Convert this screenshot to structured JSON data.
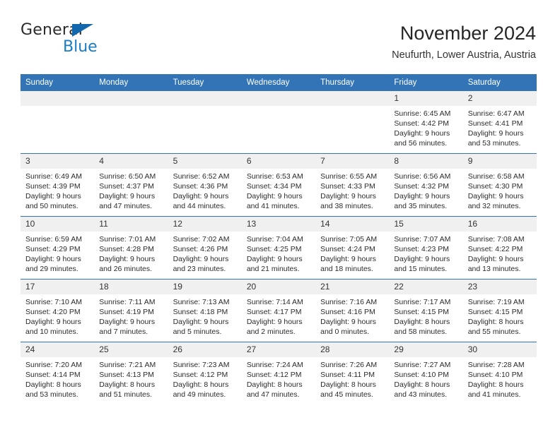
{
  "brand": {
    "name_top": "General",
    "name_bottom": "Blue",
    "triangle_color": "#1368ad",
    "blue_color": "#1b7cc4"
  },
  "header": {
    "title": "November 2024",
    "location": "Neufurth, Lower Austria, Austria"
  },
  "theme": {
    "header_blue": "#3274b5",
    "daynum_band": "#f0f0f0",
    "text": "#2b2b2b"
  },
  "calendar": {
    "weekday_headers": [
      "Sunday",
      "Monday",
      "Tuesday",
      "Wednesday",
      "Thursday",
      "Friday",
      "Saturday"
    ],
    "weeks": [
      [
        {
          "day": "",
          "empty": true
        },
        {
          "day": "",
          "empty": true
        },
        {
          "day": "",
          "empty": true
        },
        {
          "day": "",
          "empty": true
        },
        {
          "day": "",
          "empty": true
        },
        {
          "day": "1",
          "sunrise": "Sunrise: 6:45 AM",
          "sunset": "Sunset: 4:42 PM",
          "daylight1": "Daylight: 9 hours",
          "daylight2": "and 56 minutes."
        },
        {
          "day": "2",
          "sunrise": "Sunrise: 6:47 AM",
          "sunset": "Sunset: 4:41 PM",
          "daylight1": "Daylight: 9 hours",
          "daylight2": "and 53 minutes."
        }
      ],
      [
        {
          "day": "3",
          "sunrise": "Sunrise: 6:49 AM",
          "sunset": "Sunset: 4:39 PM",
          "daylight1": "Daylight: 9 hours",
          "daylight2": "and 50 minutes."
        },
        {
          "day": "4",
          "sunrise": "Sunrise: 6:50 AM",
          "sunset": "Sunset: 4:37 PM",
          "daylight1": "Daylight: 9 hours",
          "daylight2": "and 47 minutes."
        },
        {
          "day": "5",
          "sunrise": "Sunrise: 6:52 AM",
          "sunset": "Sunset: 4:36 PM",
          "daylight1": "Daylight: 9 hours",
          "daylight2": "and 44 minutes."
        },
        {
          "day": "6",
          "sunrise": "Sunrise: 6:53 AM",
          "sunset": "Sunset: 4:34 PM",
          "daylight1": "Daylight: 9 hours",
          "daylight2": "and 41 minutes."
        },
        {
          "day": "7",
          "sunrise": "Sunrise: 6:55 AM",
          "sunset": "Sunset: 4:33 PM",
          "daylight1": "Daylight: 9 hours",
          "daylight2": "and 38 minutes."
        },
        {
          "day": "8",
          "sunrise": "Sunrise: 6:56 AM",
          "sunset": "Sunset: 4:32 PM",
          "daylight1": "Daylight: 9 hours",
          "daylight2": "and 35 minutes."
        },
        {
          "day": "9",
          "sunrise": "Sunrise: 6:58 AM",
          "sunset": "Sunset: 4:30 PM",
          "daylight1": "Daylight: 9 hours",
          "daylight2": "and 32 minutes."
        }
      ],
      [
        {
          "day": "10",
          "sunrise": "Sunrise: 6:59 AM",
          "sunset": "Sunset: 4:29 PM",
          "daylight1": "Daylight: 9 hours",
          "daylight2": "and 29 minutes."
        },
        {
          "day": "11",
          "sunrise": "Sunrise: 7:01 AM",
          "sunset": "Sunset: 4:28 PM",
          "daylight1": "Daylight: 9 hours",
          "daylight2": "and 26 minutes."
        },
        {
          "day": "12",
          "sunrise": "Sunrise: 7:02 AM",
          "sunset": "Sunset: 4:26 PM",
          "daylight1": "Daylight: 9 hours",
          "daylight2": "and 23 minutes."
        },
        {
          "day": "13",
          "sunrise": "Sunrise: 7:04 AM",
          "sunset": "Sunset: 4:25 PM",
          "daylight1": "Daylight: 9 hours",
          "daylight2": "and 21 minutes."
        },
        {
          "day": "14",
          "sunrise": "Sunrise: 7:05 AM",
          "sunset": "Sunset: 4:24 PM",
          "daylight1": "Daylight: 9 hours",
          "daylight2": "and 18 minutes."
        },
        {
          "day": "15",
          "sunrise": "Sunrise: 7:07 AM",
          "sunset": "Sunset: 4:23 PM",
          "daylight1": "Daylight: 9 hours",
          "daylight2": "and 15 minutes."
        },
        {
          "day": "16",
          "sunrise": "Sunrise: 7:08 AM",
          "sunset": "Sunset: 4:22 PM",
          "daylight1": "Daylight: 9 hours",
          "daylight2": "and 13 minutes."
        }
      ],
      [
        {
          "day": "17",
          "sunrise": "Sunrise: 7:10 AM",
          "sunset": "Sunset: 4:20 PM",
          "daylight1": "Daylight: 9 hours",
          "daylight2": "and 10 minutes."
        },
        {
          "day": "18",
          "sunrise": "Sunrise: 7:11 AM",
          "sunset": "Sunset: 4:19 PM",
          "daylight1": "Daylight: 9 hours",
          "daylight2": "and 7 minutes."
        },
        {
          "day": "19",
          "sunrise": "Sunrise: 7:13 AM",
          "sunset": "Sunset: 4:18 PM",
          "daylight1": "Daylight: 9 hours",
          "daylight2": "and 5 minutes."
        },
        {
          "day": "20",
          "sunrise": "Sunrise: 7:14 AM",
          "sunset": "Sunset: 4:17 PM",
          "daylight1": "Daylight: 9 hours",
          "daylight2": "and 2 minutes."
        },
        {
          "day": "21",
          "sunrise": "Sunrise: 7:16 AM",
          "sunset": "Sunset: 4:16 PM",
          "daylight1": "Daylight: 9 hours",
          "daylight2": "and 0 minutes."
        },
        {
          "day": "22",
          "sunrise": "Sunrise: 7:17 AM",
          "sunset": "Sunset: 4:15 PM",
          "daylight1": "Daylight: 8 hours",
          "daylight2": "and 58 minutes."
        },
        {
          "day": "23",
          "sunrise": "Sunrise: 7:19 AM",
          "sunset": "Sunset: 4:15 PM",
          "daylight1": "Daylight: 8 hours",
          "daylight2": "and 55 minutes."
        }
      ],
      [
        {
          "day": "24",
          "sunrise": "Sunrise: 7:20 AM",
          "sunset": "Sunset: 4:14 PM",
          "daylight1": "Daylight: 8 hours",
          "daylight2": "and 53 minutes."
        },
        {
          "day": "25",
          "sunrise": "Sunrise: 7:21 AM",
          "sunset": "Sunset: 4:13 PM",
          "daylight1": "Daylight: 8 hours",
          "daylight2": "and 51 minutes."
        },
        {
          "day": "26",
          "sunrise": "Sunrise: 7:23 AM",
          "sunset": "Sunset: 4:12 PM",
          "daylight1": "Daylight: 8 hours",
          "daylight2": "and 49 minutes."
        },
        {
          "day": "27",
          "sunrise": "Sunrise: 7:24 AM",
          "sunset": "Sunset: 4:12 PM",
          "daylight1": "Daylight: 8 hours",
          "daylight2": "and 47 minutes."
        },
        {
          "day": "28",
          "sunrise": "Sunrise: 7:26 AM",
          "sunset": "Sunset: 4:11 PM",
          "daylight1": "Daylight: 8 hours",
          "daylight2": "and 45 minutes."
        },
        {
          "day": "29",
          "sunrise": "Sunrise: 7:27 AM",
          "sunset": "Sunset: 4:10 PM",
          "daylight1": "Daylight: 8 hours",
          "daylight2": "and 43 minutes."
        },
        {
          "day": "30",
          "sunrise": "Sunrise: 7:28 AM",
          "sunset": "Sunset: 4:10 PM",
          "daylight1": "Daylight: 8 hours",
          "daylight2": "and 41 minutes."
        }
      ]
    ]
  }
}
